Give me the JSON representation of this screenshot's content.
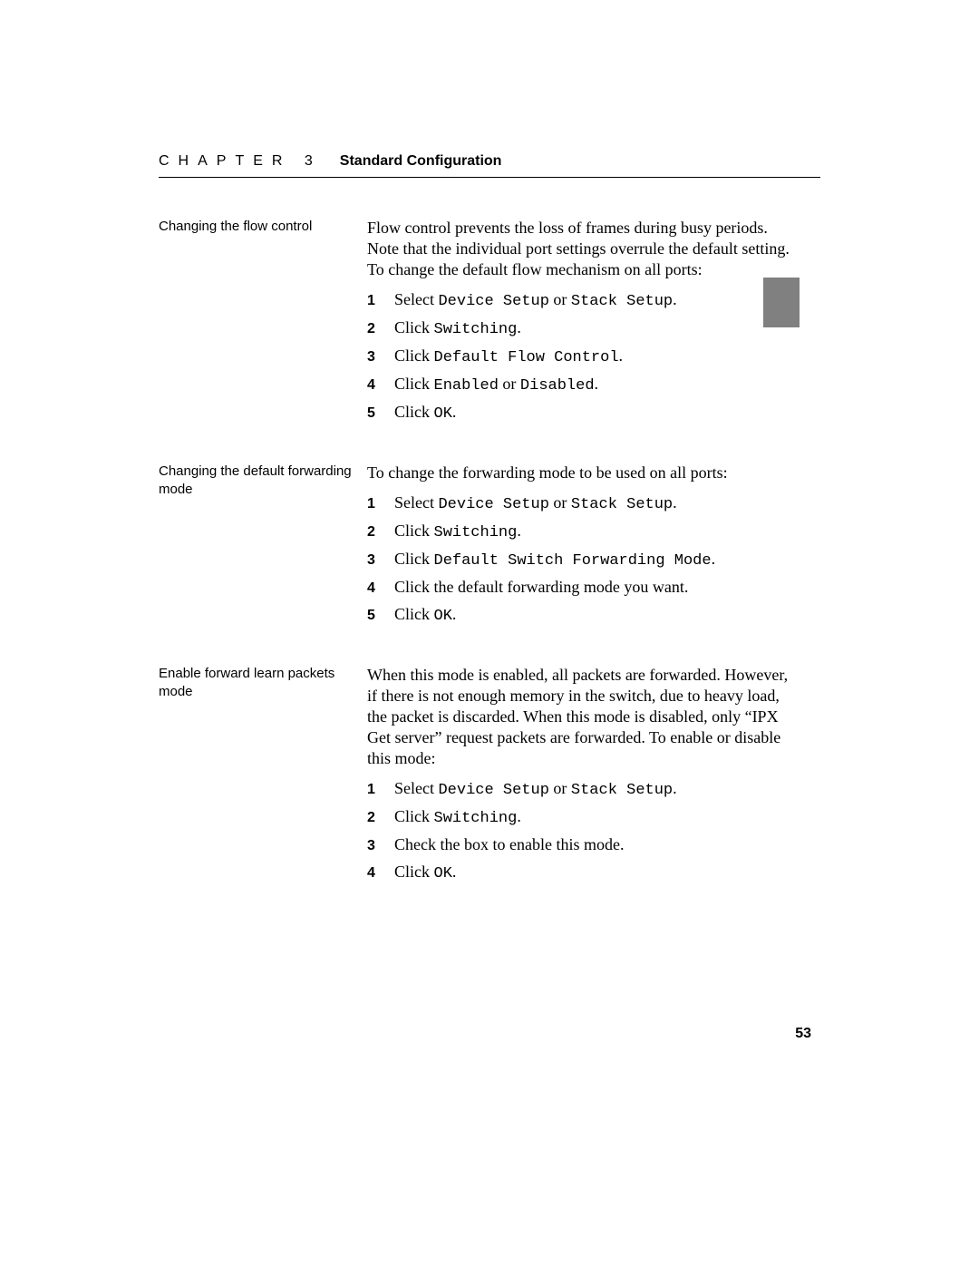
{
  "header": {
    "chapter_spaced": "CHAPTER 3",
    "chapter_title": "Standard Configuration"
  },
  "page_number": "53",
  "sections": [
    {
      "label": "Changing the flow control",
      "intro": "Flow control prevents the loss of frames during busy periods. Note that the individual port settings overrule the default setting. To change the default flow mechanism on all ports:",
      "steps": [
        {
          "num": "1",
          "pre": "Select ",
          "a": "Device Setup",
          "mid": " or ",
          "b": "Stack Setup",
          "post": "."
        },
        {
          "num": "2",
          "pre": "Click ",
          "a": "Switching",
          "mid": "",
          "b": "",
          "post": "."
        },
        {
          "num": "3",
          "pre": "Click ",
          "a": "Default Flow Control",
          "mid": "",
          "b": "",
          "post": "."
        },
        {
          "num": "4",
          "pre": "Click ",
          "a": "Enabled",
          "mid": " or ",
          "b": "Disabled",
          "post": "."
        },
        {
          "num": "5",
          "pre": "Click ",
          "a": "OK",
          "mid": "",
          "b": "",
          "post": "."
        }
      ]
    },
    {
      "label": "Changing the default forwarding mode",
      "intro": "To change the forwarding mode to be used on all ports:",
      "steps": [
        {
          "num": "1",
          "pre": "Select ",
          "a": "Device Setup",
          "mid": " or ",
          "b": "Stack Setup",
          "post": "."
        },
        {
          "num": "2",
          "pre": "Click ",
          "a": "Switching",
          "mid": "",
          "b": "",
          "post": "."
        },
        {
          "num": "3",
          "pre": "Click ",
          "a": "Default Switch Forwarding Mode",
          "mid": "",
          "b": "",
          "post": "."
        },
        {
          "num": "4",
          "pre": "Click the default forwarding mode you want.",
          "a": "",
          "mid": "",
          "b": "",
          "post": ""
        },
        {
          "num": "5",
          "pre": "Click ",
          "a": "OK",
          "mid": "",
          "b": "",
          "post": "."
        }
      ]
    },
    {
      "label": "Enable forward learn packets mode",
      "intro": "When this mode is enabled, all packets are forwarded. However, if there is not enough memory in the switch, due to heavy load, the packet is discarded. When this mode is disabled, only “IPX Get server” request packets are forwarded. To enable or disable this mode:",
      "steps": [
        {
          "num": "1",
          "pre": "Select ",
          "a": "Device Setup",
          "mid": " or ",
          "b": "Stack Setup",
          "post": "."
        },
        {
          "num": "2",
          "pre": "Click ",
          "a": "Switching",
          "mid": "",
          "b": "",
          "post": "."
        },
        {
          "num": "3",
          "pre": "Check the box to enable this mode.",
          "a": "",
          "mid": "",
          "b": "",
          "post": ""
        },
        {
          "num": "4",
          "pre": "Click ",
          "a": "OK",
          "mid": "",
          "b": "",
          "post": "."
        }
      ]
    }
  ]
}
